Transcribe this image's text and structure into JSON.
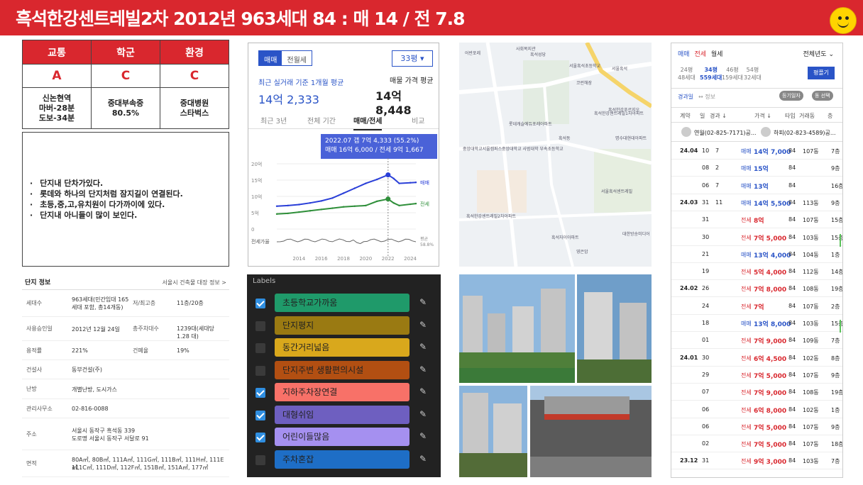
{
  "header": {
    "title": "흑석한강센트레빌2차   2012년 963세대   84 : 매 14 / 전 7.8"
  },
  "score": {
    "headers": [
      "교통",
      "학군",
      "환경"
    ],
    "grades": [
      "A",
      "C",
      "C"
    ],
    "details": [
      [
        "신논현역",
        "마버-28분",
        "도보-34분"
      ],
      [
        "중대부속중",
        "80.5%"
      ],
      [
        "중대병원",
        "스타벅스"
      ]
    ]
  },
  "notes": [
    "단지내 단차가있다.",
    "롯데와 하나의 단지처럼 잠지길이 연결된다.",
    "초등,중,고,유치원이  다가까이에 있다.",
    "단지내 아니들이 많이 보인다."
  ],
  "info": {
    "title": "단지 정보",
    "link": "서울시 건축물 대장 정보 >",
    "rows": [
      {
        "k": "세대수",
        "v": [
          "963세대(민간임대 165",
          "세대 포함, 총14개동)"
        ],
        "k2": "저/최고층",
        "v2": "11층/20층"
      },
      {
        "k": "사용승인일",
        "v": [
          "2012년 12월 24일"
        ],
        "k2": "총주차대수",
        "v2": "1239대(세대당 1.28 대)"
      },
      {
        "k": "용적률",
        "v": [
          "221%"
        ],
        "k2": "건폐율",
        "v2": "19%"
      },
      {
        "k": "건설사",
        "v": [
          "동부건설(주)"
        ],
        "k2": "",
        "v2": ""
      },
      {
        "k": "난방",
        "v": [
          "개별난방, 도시가스"
        ],
        "k2": "",
        "v2": ""
      },
      {
        "k": "관리사무소",
        "v": [
          "02-816-0088"
        ],
        "k2": "",
        "v2": ""
      },
      {
        "k": "주소",
        "v": [
          "서울시 동작구 흑석동 339",
          "도로명  서울시 동작구 서달로 91"
        ],
        "k2": "",
        "v2": ""
      },
      {
        "k": "면적",
        "v": [
          "80A㎡, 80B㎡, 111A㎡, 111G㎡, 111B㎡, 111H㎡, 111E㎡,",
          "111C㎡, 111D㎡, 112F㎡, 151B㎡, 151A㎡, 177㎡"
        ],
        "k2": "",
        "v2": ""
      }
    ]
  },
  "price": {
    "btn_sale": "매매",
    "btn_jeonse": "전월세",
    "pyeong": "33평",
    "recent_label": "최근 실거래 기준 1개월 평균",
    "recent_value": "14억 2,333",
    "listing_label": "매물 가격 평균",
    "listing_value": "14억 8,448",
    "tabs": [
      "최근 3년",
      "전체 기간",
      "매매/전세",
      "비교"
    ],
    "tooltip_1": "2022.07  갭 7억 4,333 (55.2%)",
    "tooltip_2": "매매 16억 6,000 / 전세 9억 1,667",
    "y_label_sale": "매매",
    "y_label_jeonse": "전세",
    "ratio_label": "전세가율",
    "ratio_avg_1": "평균",
    "ratio_avg_2": "58.8%"
  },
  "chart_data": {
    "type": "line",
    "x": [
      2012,
      2013,
      2014,
      2015,
      2016,
      2017,
      2018,
      2019,
      2020,
      2021,
      2022,
      2022.5,
      2023,
      2024,
      2024.5
    ],
    "series": [
      {
        "name": "매매",
        "values": [
          7.0,
          7.2,
          7.5,
          8.0,
          8.6,
          9.5,
          11.0,
          12.5,
          14.0,
          15.2,
          16.6,
          15.5,
          14.0,
          14.2,
          14.3
        ]
      },
      {
        "name": "전세",
        "values": [
          4.6,
          4.8,
          5.2,
          5.6,
          6.0,
          6.4,
          6.8,
          7.0,
          7.2,
          8.5,
          9.2,
          8.0,
          7.2,
          7.6,
          7.8
        ]
      }
    ],
    "ylim": [
      0,
      20
    ],
    "yticks": [
      "20억",
      "15억",
      "10억",
      "5억",
      "0"
    ],
    "xticks": [
      "2014",
      "2016",
      "2018",
      "2020",
      "2022",
      "2024"
    ]
  },
  "map": {
    "labels": [
      "어반포레",
      "흑석성당",
      "사회복지관",
      "서울흑석초등학교",
      "서울흑석",
      "코런해장",
      "흑석한강센트레빌1차아파트",
      "중앙대학교 사범대학 부속초등학교",
      "중앙대학교서울캠퍼스",
      "흑석한강센트레빌2차아파트",
      "서울흑석센트레빌",
      "롯데캐슬에듀포레아파트",
      "흑석동",
      "명수대현대아파트",
      "흑석한강푸르지오",
      "흑석자이아파트",
      "대한방송미디어",
      "영은암"
    ]
  },
  "labels": {
    "title": "Labels",
    "items": [
      {
        "label": "초등학교가까움",
        "checked": true,
        "color": "#1f9a6a"
      },
      {
        "label": "단지평지",
        "checked": false,
        "color": "#9a7a12"
      },
      {
        "label": "동간거리넓음",
        "checked": false,
        "color": "#d9a81c"
      },
      {
        "label": "단지주변 생활편의시설",
        "checked": false,
        "color": "#b24f12"
      },
      {
        "label": "지하주차장연결",
        "checked": true,
        "color": "#f87168"
      },
      {
        "label": "대형쉬임",
        "checked": true,
        "color": "#6e5fc0"
      },
      {
        "label": "어린이들많음",
        "checked": true,
        "color": "#a590f0"
      },
      {
        "label": "주차혼잡",
        "checked": false,
        "color": "#1e6ec6"
      }
    ]
  },
  "tx": {
    "tabs": [
      "매매",
      "전세",
      "월세"
    ],
    "period": "전체년도",
    "pyeongs": [
      {
        "p": "24평",
        "h": "48세대"
      },
      {
        "p": "34평",
        "h": "559세대"
      },
      {
        "p": "46평",
        "h": "159세대"
      },
      {
        "p": "54평",
        "h": "32세대"
      }
    ],
    "btn": "평플기",
    "sub_left": "경과일",
    "sub_mid": "↔ 정보",
    "sub_b1": "등기일자",
    "sub_b2": "동 선택",
    "cols": [
      "계약",
      "일",
      "경과 ↓",
      "가격 ↓",
      "타입",
      "거래동",
      "층"
    ],
    "agents": [
      "연월(02-825-7171)공...",
      "하피(02-823-4589)공..."
    ],
    "rows": [
      {
        "ym": "24.04",
        "d": "10",
        "e": "7",
        "t": "매매",
        "p": "14억 7,000",
        "ty": "84",
        "dong": "107동",
        "f": "7층",
        "g": false
      },
      {
        "ym": "",
        "d": "08",
        "e": "2",
        "t": "매매",
        "p": "15억",
        "ty": "84",
        "dong": "",
        "f": "9층",
        "g": false
      },
      {
        "ym": "",
        "d": "06",
        "e": "7",
        "t": "매매",
        "p": "13억",
        "ty": "84",
        "dong": "",
        "f": "16층",
        "g": false
      },
      {
        "ym": "24.03",
        "d": "31",
        "e": "11",
        "t": "매매",
        "p": "14억 5,500",
        "ty": "84",
        "dong": "113동",
        "f": "9층",
        "g": false
      },
      {
        "ym": "",
        "d": "31",
        "e": "",
        "t": "전세",
        "p": "8억",
        "ty": "84",
        "dong": "107동",
        "f": "15층",
        "g": false
      },
      {
        "ym": "",
        "d": "30",
        "e": "",
        "t": "전세",
        "p": "7억 5,000",
        "ty": "84",
        "dong": "103동",
        "f": "15층",
        "g": true
      },
      {
        "ym": "",
        "d": "21",
        "e": "",
        "t": "매매",
        "p": "13억 4,000",
        "ty": "84",
        "dong": "104동",
        "f": "1층",
        "g": false
      },
      {
        "ym": "",
        "d": "19",
        "e": "",
        "t": "전세",
        "p": "5억 4,000",
        "ty": "84",
        "dong": "112동",
        "f": "14층",
        "g": false
      },
      {
        "ym": "24.02",
        "d": "26",
        "e": "",
        "t": "전세",
        "p": "7억 8,000",
        "ty": "84",
        "dong": "108동",
        "f": "19층",
        "g": false
      },
      {
        "ym": "",
        "d": "24",
        "e": "",
        "t": "전세",
        "p": "7억",
        "ty": "84",
        "dong": "107동",
        "f": "2층",
        "g": false
      },
      {
        "ym": "",
        "d": "18",
        "e": "",
        "t": "매매",
        "p": "13억 8,000",
        "ty": "84",
        "dong": "103동",
        "f": "15층",
        "g": true
      },
      {
        "ym": "",
        "d": "01",
        "e": "",
        "t": "전세",
        "p": "7억 9,000",
        "ty": "84",
        "dong": "109동",
        "f": "7층",
        "g": false
      },
      {
        "ym": "24.01",
        "d": "30",
        "e": "",
        "t": "전세",
        "p": "6억 4,500",
        "ty": "84",
        "dong": "102동",
        "f": "8층",
        "g": false
      },
      {
        "ym": "",
        "d": "29",
        "e": "",
        "t": "전세",
        "p": "7억 5,000",
        "ty": "84",
        "dong": "107동",
        "f": "9층",
        "g": false
      },
      {
        "ym": "",
        "d": "07",
        "e": "",
        "t": "전세",
        "p": "7억 9,000",
        "ty": "84",
        "dong": "108동",
        "f": "19층",
        "g": false
      },
      {
        "ym": "",
        "d": "06",
        "e": "",
        "t": "전세",
        "p": "6억 8,000",
        "ty": "84",
        "dong": "102동",
        "f": "1층",
        "g": false
      },
      {
        "ym": "",
        "d": "06",
        "e": "",
        "t": "전세",
        "p": "7억 5,000",
        "ty": "84",
        "dong": "107동",
        "f": "9층",
        "g": false
      },
      {
        "ym": "",
        "d": "02",
        "e": "",
        "t": "전세",
        "p": "7억 5,000",
        "ty": "84",
        "dong": "107동",
        "f": "18층",
        "g": false
      },
      {
        "ym": "23.12",
        "d": "31",
        "e": "",
        "t": "전세",
        "p": "9억 3,000",
        "ty": "84",
        "dong": "103동",
        "f": "7층",
        "g": false
      }
    ]
  }
}
